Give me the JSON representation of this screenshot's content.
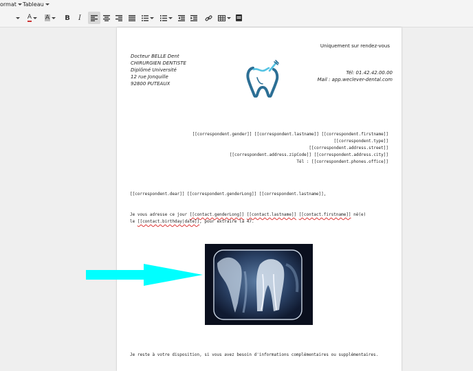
{
  "menubar": {
    "format_label": "ormat",
    "table_label": "Tableau"
  },
  "toolbar": {
    "text_color_glyph": "A",
    "highlight_glyph": "A",
    "bold_glyph": "B",
    "italic_glyph": "I"
  },
  "letterhead": {
    "doctor_name": "Docteur BELLE Dent",
    "specialty": "CHIRURGIEN DENTISTE",
    "diploma": "Diplômé Université",
    "street": "12 rue Jonquille",
    "city": "92800 PUTEAUX",
    "appointment_note": "Uniquement sur rendez-vous",
    "phone": "Tél: 01.42.42.00.00",
    "mail": "Mail : app.weclever-dental.com"
  },
  "recipient": {
    "line1": "[[correspondent.gender]] [[correspondent.lastname]] [[correspondent.firstname]]",
    "line2": "[[correspondent.type]]",
    "line3": "[[correspondent.address.street]]",
    "line4": "[[correspondent.address.zipCode]] [[correspondent.address.city]]",
    "line5": "Tél : [[correspondent.phones.office]]"
  },
  "body": {
    "greeting": "[[correspondent.dear]] [[correspondent.genderLong]] [[correspondent.lastname]],",
    "p1_a": "Je vous adresse ce jour ",
    "p1_tok1": "[[contact.genderLong]]",
    "p1_tok2": "[[contact.lastname]]",
    "p1_tok3": "[[contact.firstname]]",
    "p1_b": " né(e)",
    "p2_a": "le ",
    "p2_tok": "[[contact.birthday|date]]",
    "p2_b": ", pour extraire la 47.",
    "closing": "Je reste à votre disposition, si vous avez besoin d'informations complémentaires ou supplémentaires."
  },
  "colors": {
    "arrow": "#00ffff",
    "logo_primary": "#2c6f95",
    "logo_accent": "#55c3e3"
  }
}
